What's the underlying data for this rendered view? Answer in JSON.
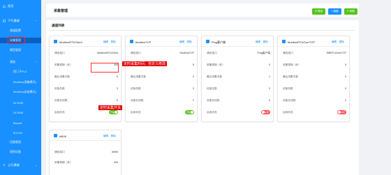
{
  "sidebar": {
    "items": [
      {
        "label": "首页",
        "caret": ""
      },
      {
        "label": "下行通道",
        "caret": "⌃"
      },
      {
        "label": "通道配置",
        "caret": ""
      },
      {
        "label": "采集管理",
        "caret": ""
      },
      {
        "label": "模型管理",
        "caret": ""
      },
      {
        "label": "通道",
        "caret": "⌃"
      },
      {
        "label": "西门子PLC",
        "caret": ""
      },
      {
        "label": "Modbus(采集模式)",
        "caret": ""
      },
      {
        "label": "Modbus(自由模式)",
        "caret": ""
      },
      {
        "label": "DLT645",
        "caret": ""
      },
      {
        "label": "DLT698",
        "caret": ""
      },
      {
        "label": "Bacnet",
        "caret": ""
      },
      {
        "label": "IEC104",
        "caret": ""
      },
      {
        "label": "设备管理",
        "caret": ""
      },
      {
        "label": "规则设备",
        "caret": ""
      },
      {
        "label": "上行通道",
        "caret": "⌄"
      }
    ]
  },
  "header": {
    "title": "采集管理",
    "buttons": [
      {
        "label": "⊞ 筛选",
        "color": "#52c41a"
      },
      {
        "label": "+ 新建",
        "color": "#1890ff"
      },
      {
        "label": "⟳ 刷新",
        "color": "#52c41a"
      }
    ]
  },
  "section": {
    "title": "通道列表"
  },
  "cards": [
    {
      "name": "ModbusRTUClient",
      "edit": "编辑",
      "delete": "删除",
      "rows": [
        {
          "label": "通信接口",
          "value": "ModbusRTUClient"
        },
        {
          "label": "采集周期（秒）",
          "value": "300"
        },
        {
          "label": "最后采集次数",
          "value": "0"
        },
        {
          "label": "设备总数",
          "value": "3"
        },
        {
          "label": "设备在线数",
          "value": "0"
        },
        {
          "label": "启用状态",
          "value": "开启",
          "toggle": "on"
        }
      ]
    },
    {
      "name": "ModbusTCP",
      "edit": "编辑",
      "delete": "删除",
      "rows": [
        {
          "label": "通信接口",
          "value": "ModbusTCP"
        },
        {
          "label": "采集周期（秒）",
          "value": "5"
        },
        {
          "label": "最后采集次数",
          "value": "0"
        },
        {
          "label": "设备总数",
          "value": "2"
        },
        {
          "label": "设备在线数",
          "value": "2"
        },
        {
          "label": "启用状态",
          "value": "开启",
          "toggle": "on"
        }
      ]
    },
    {
      "name": "Ping客户端",
      "edit": "编辑",
      "delete": "删除",
      "rows": [
        {
          "label": "通信接口",
          "value": "Ping客户端"
        },
        {
          "label": "采集周期（秒）",
          "value": "0"
        },
        {
          "label": "最后采集次数",
          "value": "1"
        },
        {
          "label": "设备总数",
          "value": "0"
        },
        {
          "label": "设备在线数",
          "value": "0"
        },
        {
          "label": "启用状态",
          "value": "关闭",
          "toggle": "off"
        }
      ]
    },
    {
      "name": "ModbusRTUOverTCP",
      "edit": "编辑",
      "delete": "删除",
      "rows": [
        {
          "label": "通信接口",
          "value": "MBRTUOverTCP"
        },
        {
          "label": "采集周期（秒）",
          "value": "5"
        },
        {
          "label": "最后采集次数",
          "value": "0"
        },
        {
          "label": "设备总数",
          "value": "0"
        },
        {
          "label": "设备在线数",
          "value": "0"
        },
        {
          "label": "启用状态",
          "value": "关闭",
          "toggle": "off"
        }
      ]
    },
    {
      "name": "dl606",
      "edit": "编辑",
      "delete": "删除",
      "rows": [
        {
          "label": "通信接口",
          "value": "dl606"
        },
        {
          "label": "采集周期（秒）",
          "value": "300"
        }
      ]
    }
  ],
  "annotations": {
    "period": "定时采集时间，自定义修改",
    "switch": "定时采集开关"
  },
  "colors": {
    "sidebar": "#1890ff",
    "accent": "#1890ff",
    "success": "#52c41a",
    "danger": "#ff4d4f",
    "annotation": "#e00000"
  }
}
